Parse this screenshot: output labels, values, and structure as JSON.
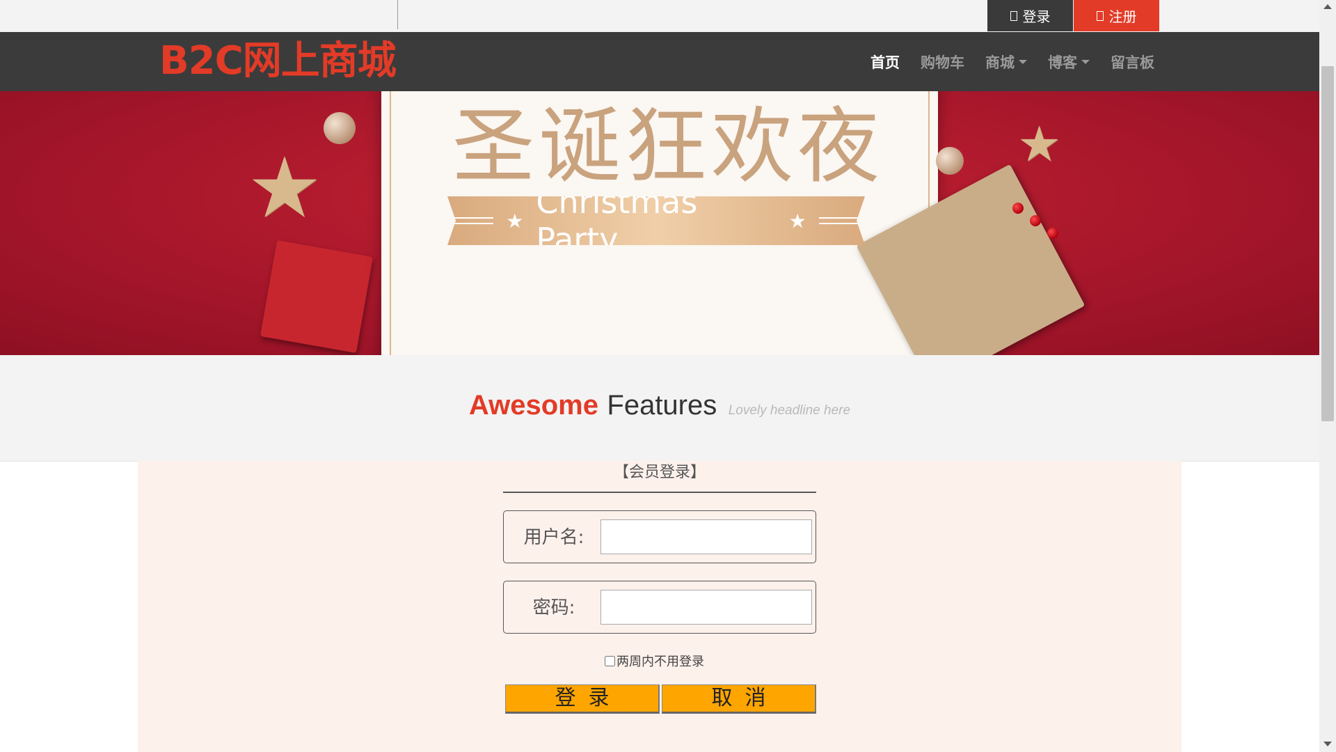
{
  "topbar": {
    "login_label": "登录",
    "register_label": "注册"
  },
  "navbar": {
    "brand": "B2C网上商城",
    "items": [
      {
        "label": "首页",
        "active": true,
        "dropdown": false
      },
      {
        "label": "购物车",
        "active": false,
        "dropdown": false
      },
      {
        "label": "商城",
        "active": false,
        "dropdown": true
      },
      {
        "label": "博客",
        "active": false,
        "dropdown": true
      },
      {
        "label": "留言板",
        "active": false,
        "dropdown": false
      }
    ]
  },
  "banner": {
    "title": "圣诞狂欢夜",
    "subtitle": "Christmas Party"
  },
  "features": {
    "accent": "Awesome",
    "main": "Features",
    "tagline": "Lovely headline here"
  },
  "login": {
    "title": "【会员登录】",
    "username_label": "用户名:",
    "username_value": "",
    "password_label": "密码:",
    "password_value": "",
    "remember_label": "两周内不用登录",
    "remember_checked": false,
    "submit_label": "登录",
    "cancel_label": "取消"
  },
  "colors": {
    "accent": "#e23b27",
    "navbar_bg": "#3b3b3b",
    "panel_bg": "#fdf1ec",
    "button_bg": "#ffa500",
    "banner_bg": "#b01829"
  }
}
